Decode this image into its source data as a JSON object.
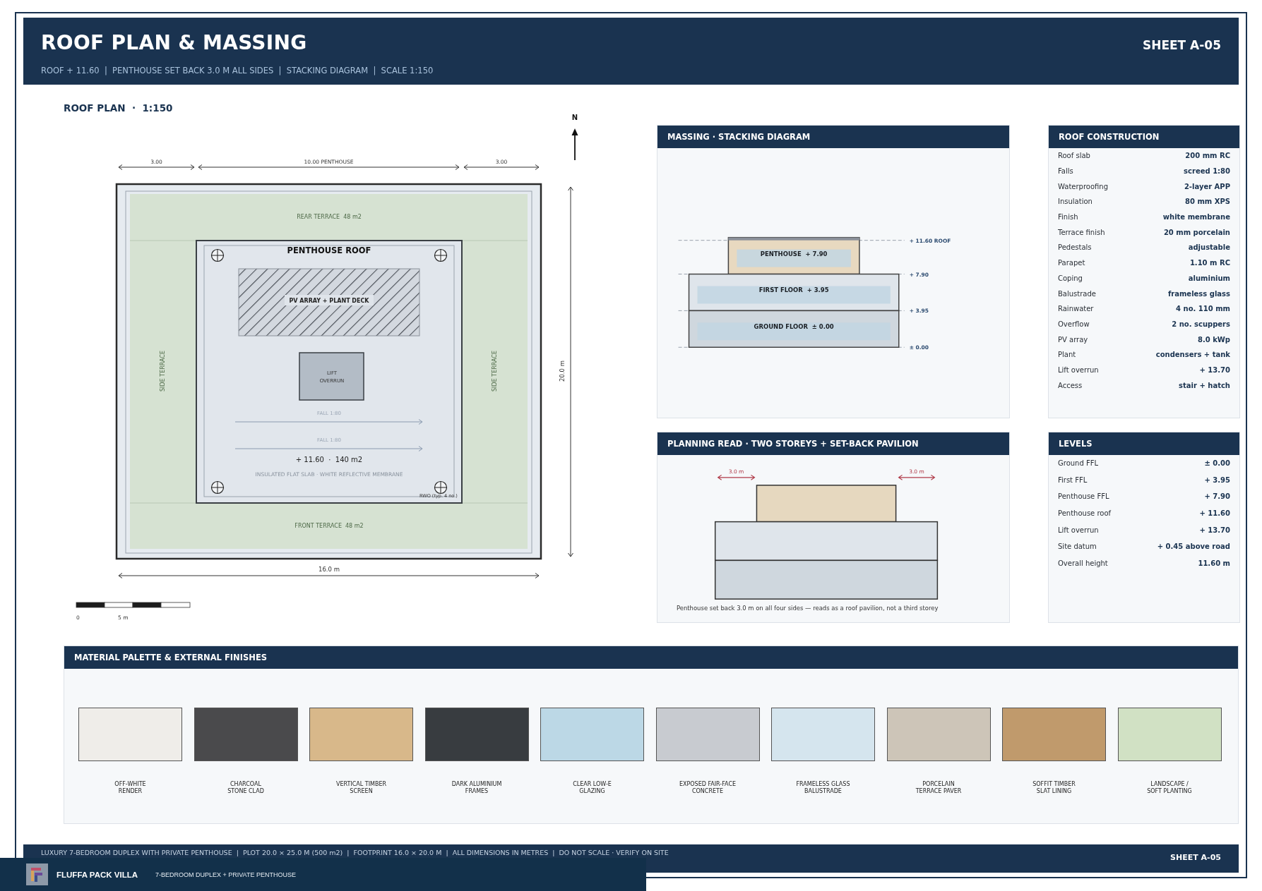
{
  "sheet": {
    "title": "ROOF PLAN & MASSING",
    "subtitle": "ROOF + 11.60  |  PENTHOUSE SET BACK 3.0 M ALL SIDES  |  STACKING DIAGRAM  |  SCALE 1:150",
    "sheet_no": "SHEET A-05"
  },
  "roof_plan": {
    "title": "ROOF PLAN  ·  1:150",
    "top_dimensions": [
      "3.00",
      "10.00 PENTHOUSE",
      "3.00"
    ],
    "width_dimension": "16.0 m",
    "depth_dimension": "20.0 m",
    "north": "N",
    "rear_terrace": "REAR TERRACE  48 m2",
    "front_terrace": "FRONT TERRACE  48 m2",
    "side_terraces": [
      "SIDE TERRACE",
      "SIDE TERRACE"
    ],
    "penthouse_title": "PENTHOUSE ROOF",
    "pv_label": "PV ARRAY + PLANT DECK",
    "lift_label": "LIFT\nOVERRUN",
    "falls": [
      "FALL 1:80",
      "FALL 1:80"
    ],
    "roof_level": "+ 11.60  ·  140 m2",
    "roof_note": "INSULATED FLAT SLAB · WHITE REFLECTIVE MEMBRANE",
    "rwo_note": "RWO (typ. 4 no.)",
    "scale_labels": [
      "0",
      "5 m"
    ]
  },
  "massing": {
    "title": "MASSING · STACKING DIAGRAM",
    "floors": [
      {
        "kind": "penthouse",
        "label": "PENTHOUSE  + 7.90"
      },
      {
        "kind": "upper",
        "label": "FIRST FLOOR  + 3.95"
      },
      {
        "kind": "ground",
        "label": "GROUND FLOOR  ± 0.00"
      }
    ],
    "levels": [
      "+ 11.60 ROOF",
      "+ 7.90",
      "+ 3.95",
      "± 0.00"
    ]
  },
  "planning": {
    "title": "PLANNING READ · TWO STOREYS + SET-BACK PAVILION",
    "setbacks": [
      "3.0 m",
      "3.0 m"
    ],
    "caption": "Penthouse set back 3.0 m on all four sides — reads as a roof pavilion, not a third storey"
  },
  "roof_construction": {
    "title": "ROOF CONSTRUCTION",
    "rows": [
      {
        "label": "Roof slab",
        "value": "200 mm RC"
      },
      {
        "label": "Falls",
        "value": "screed 1:80"
      },
      {
        "label": "Waterproofing",
        "value": "2-layer APP"
      },
      {
        "label": "Insulation",
        "value": "80 mm XPS"
      },
      {
        "label": "Finish",
        "value": "white membrane"
      },
      {
        "label": "Terrace finish",
        "value": "20 mm porcelain"
      },
      {
        "label": "Pedestals",
        "value": "adjustable"
      },
      {
        "label": "Parapet",
        "value": "1.10 m RC"
      },
      {
        "label": "Coping",
        "value": "aluminium"
      },
      {
        "label": "Balustrade",
        "value": "frameless glass"
      },
      {
        "label": "Rainwater",
        "value": "4 no. 110 mm"
      },
      {
        "label": "Overflow",
        "value": "2 no. scuppers"
      },
      {
        "label": "PV array",
        "value": "8.0 kWp"
      },
      {
        "label": "Plant",
        "value": "condensers + tank"
      },
      {
        "label": "Lift overrun",
        "value": "+ 13.70"
      },
      {
        "label": "Access",
        "value": "stair + hatch"
      }
    ]
  },
  "levels": {
    "title": "LEVELS",
    "rows": [
      {
        "label": "Ground FFL",
        "value": "± 0.00"
      },
      {
        "label": "First FFL",
        "value": "+ 3.95"
      },
      {
        "label": "Penthouse FFL",
        "value": "+ 7.90"
      },
      {
        "label": "Penthouse roof",
        "value": "+ 11.60"
      },
      {
        "label": "Lift overrun",
        "value": "+ 13.70"
      },
      {
        "label": "Site datum",
        "value": "+ 0.45 above road"
      },
      {
        "label": "Overall height",
        "value": "11.60 m"
      }
    ]
  },
  "materials": {
    "title": "MATERIAL PALETTE & EXTERNAL FINISHES",
    "items": [
      {
        "label": "OFF-WHITE\nRENDER",
        "color": "#efede9"
      },
      {
        "label": "CHARCOAL\nSTONE CLAD",
        "color": "#4a4a4c"
      },
      {
        "label": "VERTICAL TIMBER\nSCREEN",
        "color": "#d8b88a"
      },
      {
        "label": "DARK ALUMINIUM\nFRAMES",
        "color": "#383c40"
      },
      {
        "label": "CLEAR LOW-E\nGLAZING",
        "color": "#bcd8e6"
      },
      {
        "label": "EXPOSED FAIR-FACE\nCONCRETE",
        "color": "#c8cbd0"
      },
      {
        "label": "FRAMELESS GLASS\nBALUSTRADE",
        "color": "#d5e5ee"
      },
      {
        "label": "PORCELAIN\nTERRACE PAVER",
        "color": "#cdc5b8"
      },
      {
        "label": "SOFFIT TIMBER\nSLAT LINING",
        "color": "#c09a6c"
      },
      {
        "label": "LANDSCAPE /\nSOFT PLANTING",
        "color": "#d1e1c4"
      }
    ]
  },
  "footer": {
    "note": "LUXURY 7-BEDROOM DUPLEX WITH PRIVATE PENTHOUSE  |  PLOT 20.0 × 25.0 M (500 m2)  |  FOOTPRINT 16.0 × 20.0 M  |  ALL DIMENSIONS IN METRES  |  DO NOT SCALE · VERIFY ON SITE",
    "sheet_no": "SHEET A-05"
  },
  "brand": {
    "name": "FLUFFA PACK VILLA",
    "tagline": "7-BEDROOM DUPLEX + PRIVATE PENTHOUSE"
  }
}
